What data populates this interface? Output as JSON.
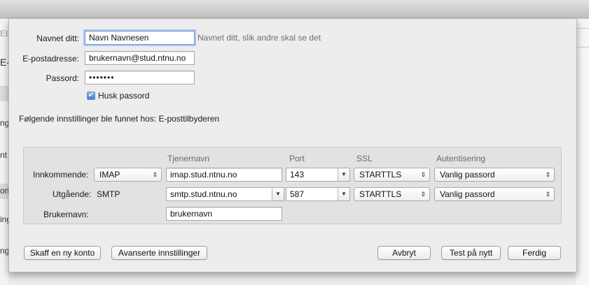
{
  "account": {
    "name_label": "Navnet ditt:",
    "name_value": "Navn Navnesen",
    "name_hint": "Navnet ditt, slik andre skal se det",
    "email_label": "E-postadresse:",
    "email_value": "brukernavn@stud.ntnu.no",
    "password_label": "Passord:",
    "password_value": "•••••••",
    "remember_label": "Husk passord",
    "remember_checked": true
  },
  "found_text": "Følgende innstillinger ble funnet hos: E-posttilbyderen",
  "servers": {
    "headers": {
      "server": "Tjenernavn",
      "port": "Port",
      "ssl": "SSL",
      "auth": "Autentisering"
    },
    "incoming": {
      "label": "Innkommende:",
      "protocol": "IMAP",
      "server": "imap.stud.ntnu.no",
      "port": "143",
      "ssl": "STARTTLS",
      "auth": "Vanlig passord"
    },
    "outgoing": {
      "label": "Utgående:",
      "protocol": "SMTP",
      "server": "smtp.stud.ntnu.no",
      "port": "587",
      "ssl": "STARTTLS",
      "auth": "Vanlig passord"
    },
    "username": {
      "label": "Brukernavn:",
      "value": "brukernavn"
    }
  },
  "buttons": {
    "new_account": "Skaff en ny konto",
    "advanced": "Avanserte innstillinger",
    "cancel": "Avbryt",
    "retest": "Test på nytt",
    "done": "Ferdig"
  },
  "background": {
    "frag1": "Et",
    "frag2": "E-",
    "frag3": "ng",
    "frag4": "nt",
    "frag5": "on",
    "frag6": "ing",
    "frag7": "ngs"
  },
  "icons": {
    "popup_arrows": "⇕",
    "combo_arrow": "▼",
    "checkmark": "✔"
  }
}
